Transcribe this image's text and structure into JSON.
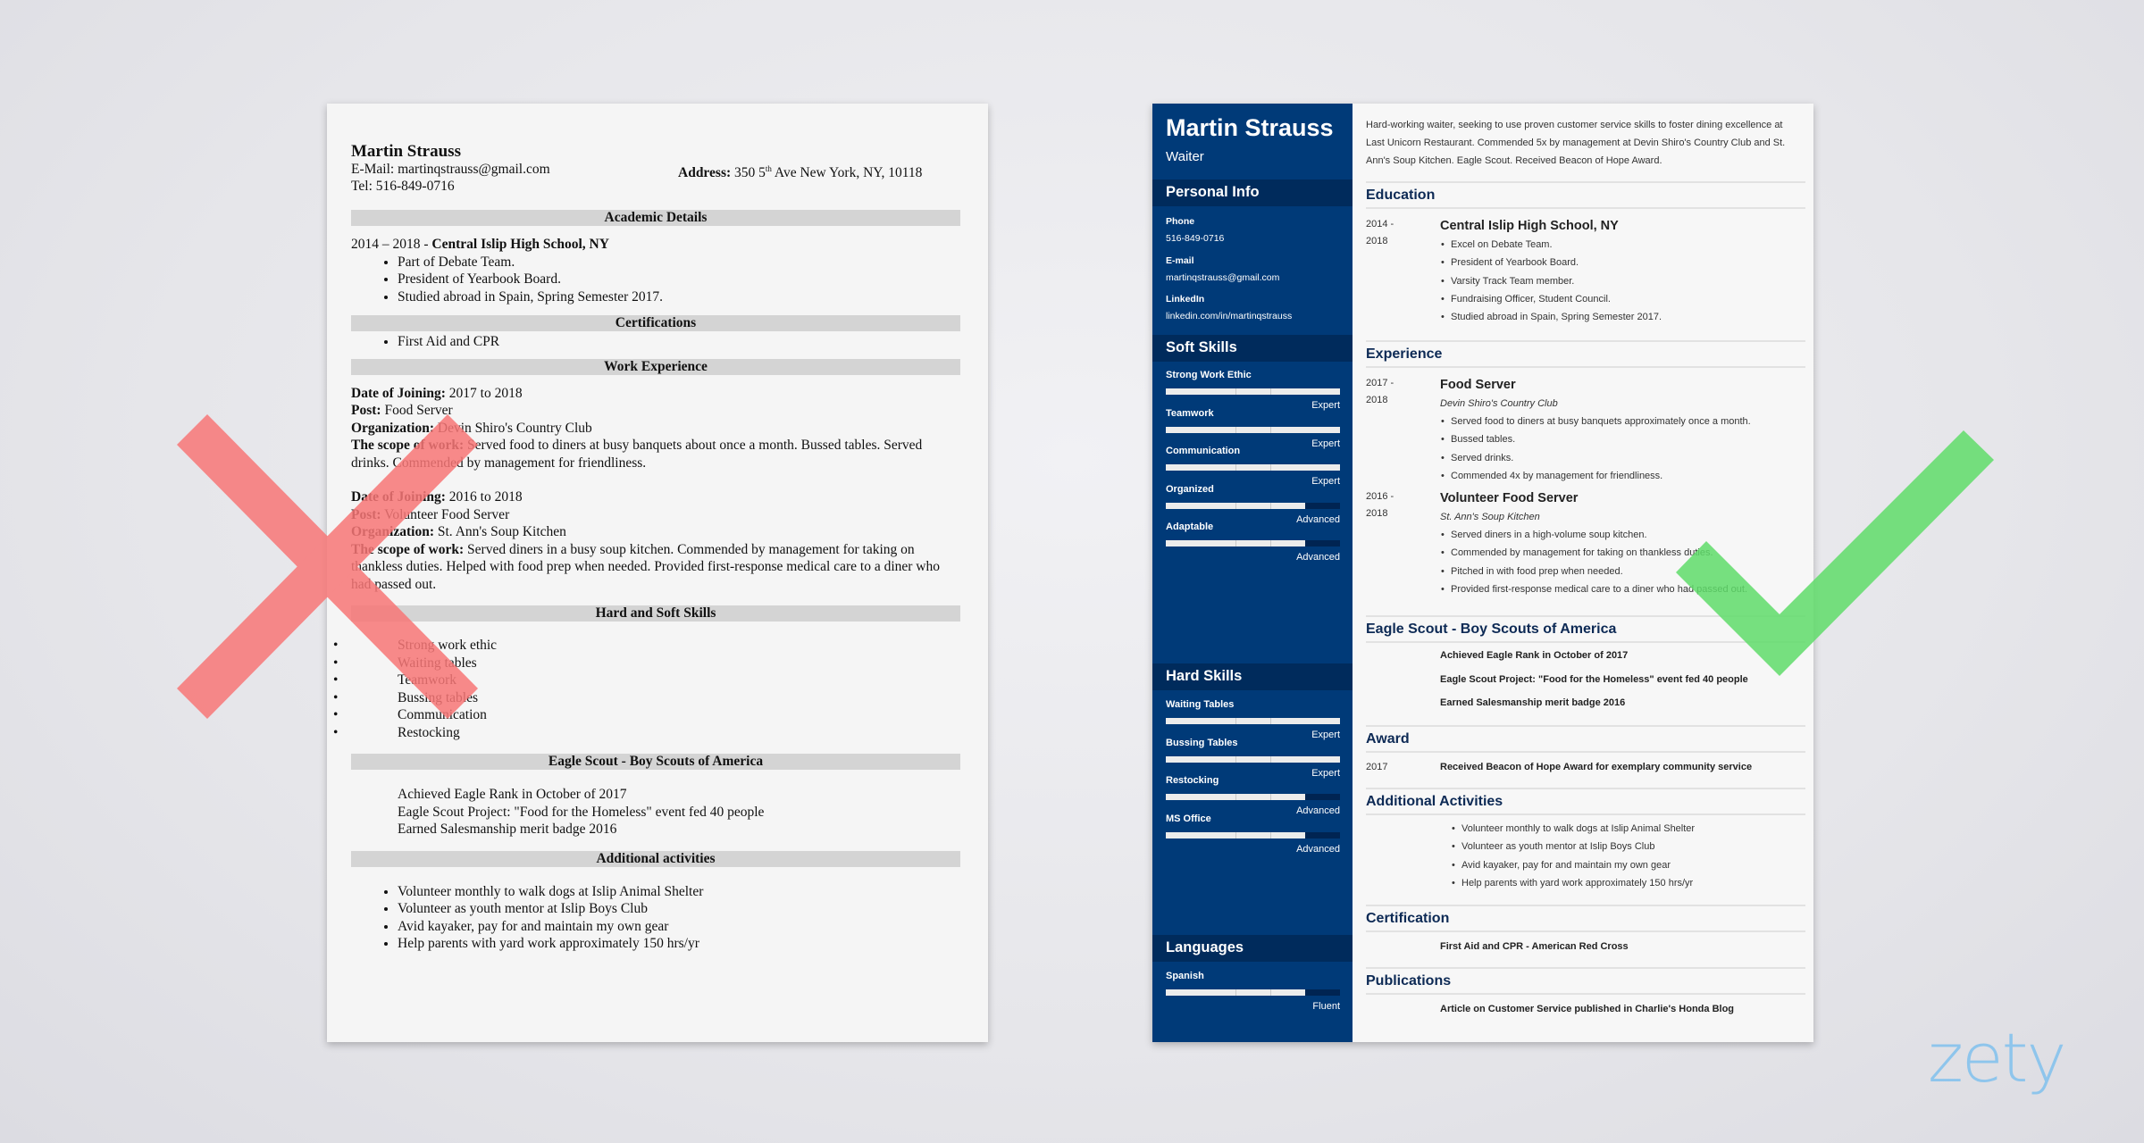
{
  "left_resume": {
    "name": "Martin Strauss",
    "email_label": "E-Mail:",
    "email": "martinqstrauss@gmail.com",
    "phone_label": "Tel:",
    "phone": "516-849-0716",
    "address_label": "Address:",
    "address_pre": "350 5",
    "address_sup": "th",
    "address_post": " Ave New York, NY, 10118",
    "sections": {
      "academic": "Academic Details",
      "certifications": "Certifications",
      "work": "Work Experience",
      "skills": "Hard and Soft Skills",
      "scout": "Eagle Scout - Boy Scouts of America",
      "activities": "Additional activities"
    },
    "education": {
      "dates": "2014 – 2018 - ",
      "school": "Central Islip High School, NY",
      "bullets": [
        "Part of Debate Team.",
        "President of Yearbook Board.",
        "Studied abroad in Spain, Spring Semester 2017."
      ]
    },
    "certifications": [
      "First Aid and CPR"
    ],
    "jobs": [
      {
        "date_label": "Date of Joining:",
        "date": " 2017 to 2018",
        "post_label": "Post:",
        "post": " Food Server",
        "org_label": "Organization:",
        "org": " Devin Shiro's Country Club",
        "scope_label": "The scope of work:",
        "scope": " Served food to diners at busy banquets about once a month. Bussed tables. Served drinks. Commended by management for friendliness."
      },
      {
        "date_label": "Date of Joining:",
        "date": " 2016 to 2018",
        "post_label": "Post:",
        "post": " Volunteer Food Server",
        "org_label": "Organization:",
        "org": " St. Ann's Soup Kitchen",
        "scope_label": "The scope of work:",
        "scope": " Served diners in a busy soup kitchen. Commended by management for taking on thankless duties. Helped with food prep when needed. Provided first-response medical care to a diner who had passed out."
      }
    ],
    "skills": [
      "Strong work ethic",
      "Waiting tables",
      "Teamwork",
      "Bussing tables",
      "Communication",
      "Restocking"
    ],
    "scout": [
      "Achieved Eagle Rank in October of 2017",
      "Eagle Scout Project: \"Food for the Homeless\" event fed 40 people",
      "Earned Salesmanship merit badge 2016"
    ],
    "activities": [
      "Volunteer monthly to walk dogs at Islip Animal Shelter",
      "Volunteer as youth mentor at Islip Boys Club",
      "Avid kayaker, pay for and maintain my own gear",
      "Help parents with yard work approximately 150 hrs/yr"
    ]
  },
  "right_resume": {
    "name": "Martin Strauss",
    "title": "Waiter",
    "sidebar": {
      "personal_info_heading": "Personal Info",
      "phone_label": "Phone",
      "phone": "516-849-0716",
      "email_label": "E-mail",
      "email": "martinqstrauss@gmail.com",
      "linkedin_label": "LinkedIn",
      "linkedin": "linkedin.com/in/martinqstrauss",
      "soft_skills_heading": "Soft Skills",
      "soft_skills": [
        {
          "name": "Strong Work Ethic",
          "level": "Expert",
          "fraction": 1.0
        },
        {
          "name": "Teamwork",
          "level": "Expert",
          "fraction": 1.0
        },
        {
          "name": "Communication",
          "level": "Expert",
          "fraction": 1.0
        },
        {
          "name": "Organized",
          "level": "Advanced",
          "fraction": 0.8
        },
        {
          "name": "Adaptable",
          "level": "Advanced",
          "fraction": 0.8
        }
      ],
      "hard_skills_heading": "Hard Skills",
      "hard_skills": [
        {
          "name": "Waiting Tables",
          "level": "Expert",
          "fraction": 1.0
        },
        {
          "name": "Bussing Tables",
          "level": "Expert",
          "fraction": 1.0
        },
        {
          "name": "Restocking",
          "level": "Advanced",
          "fraction": 0.8
        },
        {
          "name": "MS Office",
          "level": "Advanced",
          "fraction": 0.8
        }
      ],
      "languages_heading": "Languages",
      "languages": [
        {
          "name": "Spanish",
          "level": "Fluent",
          "fraction": 0.8
        }
      ]
    },
    "summary": "Hard-working waiter, seeking to use proven customer service skills to foster dining excellence at Last Unicorn Restaurant. Commended 5x by management at Devin Shiro's Country Club and St. Ann's Soup Kitchen. Eagle Scout. Received Beacon of Hope Award.",
    "education": {
      "heading": "Education",
      "date_start": "2014 -",
      "date_end": "2018",
      "school": "Central Islip High School, NY",
      "bullets": [
        "Excel on Debate Team.",
        "President of Yearbook Board.",
        "Varsity Track Team member.",
        "Fundraising Officer, Student Council.",
        "Studied abroad in Spain, Spring Semester 2017."
      ]
    },
    "experience": {
      "heading": "Experience",
      "jobs": [
        {
          "date_start": "2017 -",
          "date_end": "2018",
          "title": "Food Server",
          "org": "Devin Shiro's Country Club",
          "bullets": [
            "Served food to diners at busy banquets approximately once a month.",
            "Bussed tables.",
            "Served drinks.",
            "Commended 4x by management for friendliness."
          ]
        },
        {
          "date_start": "2016 -",
          "date_end": "2018",
          "title": "Volunteer Food Server",
          "org": "St. Ann's Soup Kitchen",
          "bullets": [
            "Served diners in a high-volume soup kitchen.",
            "Commended by management for taking on thankless duties.",
            "Pitched in with food prep when needed.",
            "Provided first-response medical care to a diner who had passed out."
          ]
        }
      ]
    },
    "scout": {
      "heading": "Eagle Scout - Boy Scouts of America",
      "items": [
        "Achieved Eagle Rank in October of 2017",
        "Eagle Scout Project: \"Food for the Homeless\" event fed 40 people",
        "Earned Salesmanship merit badge 2016"
      ]
    },
    "award": {
      "heading": "Award",
      "year": "2017",
      "text": "Received Beacon of Hope Award for exemplary community service"
    },
    "activities": {
      "heading": "Additional Activities",
      "items": [
        "Volunteer monthly to walk dogs at Islip Animal Shelter",
        "Volunteer as youth mentor at Islip Boys Club",
        "Avid kayaker, pay for and maintain my own gear",
        "Help parents with yard work approximately 150 hrs/yr"
      ]
    },
    "certification": {
      "heading": "Certification",
      "text": "First Aid and CPR - American Red Cross"
    },
    "publications": {
      "heading": "Publications",
      "text": "Article on Customer Service published in Charlie's Honda Blog"
    }
  },
  "overlays": {
    "bad_mark": "x-mark-icon",
    "good_mark": "check-mark-icon",
    "bad_color": "#f87777",
    "good_color": "#5fdc6a"
  },
  "brand": {
    "logo_text": "zety",
    "logo_color": "#8ec5ec",
    "sidebar_color": "#003a78",
    "sidebar_heading_color": "#002b5c"
  }
}
